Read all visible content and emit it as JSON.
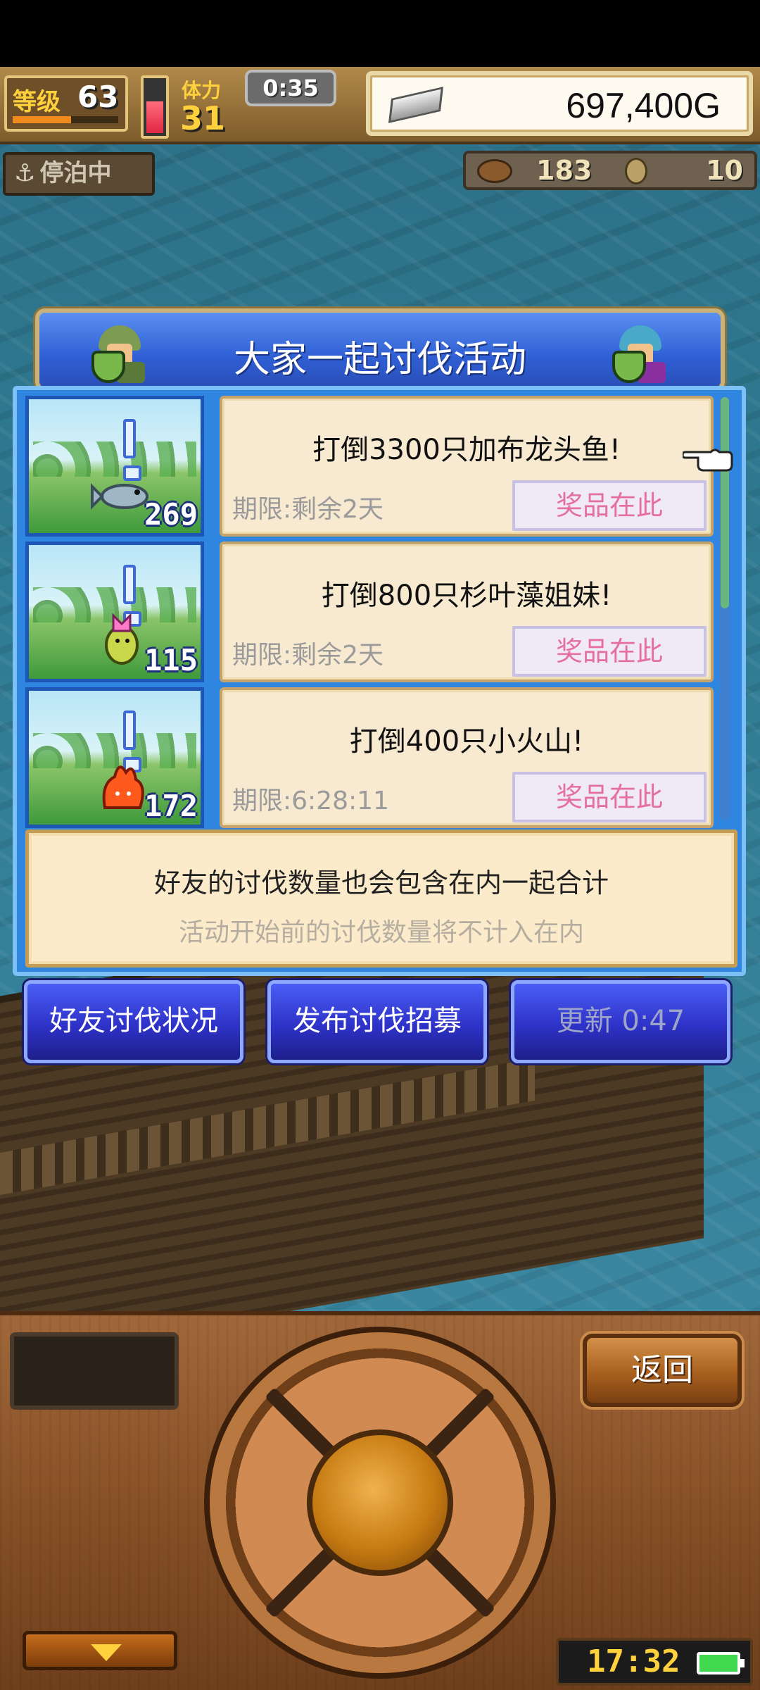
{
  "hud": {
    "level_label": "等级",
    "level": "63",
    "stamina_label": "体力",
    "stamina": "31",
    "timer": "0:35",
    "gold": "697,400G",
    "dock_status": "停泊中",
    "resource_1": "183",
    "resource_2": "10"
  },
  "event": {
    "title": "大家一起讨伐活动",
    "missions": [
      {
        "count": "269",
        "text": "打倒3300只加布龙头鱼!",
        "deadline": "期限:剩余2天",
        "prize": "奖品在此"
      },
      {
        "count": "115",
        "text": "打倒800只杉叶藻姐妹!",
        "deadline": "期限:剩余2天",
        "prize": "奖品在此"
      },
      {
        "count": "172",
        "text": "打倒400只小火山!",
        "deadline": "期限:6:28:11",
        "prize": "奖品在此"
      }
    ],
    "info_line_1": "好友的讨伐数量也会包含在内一起合计",
    "info_line_2": "活动开始前的讨伐数量将不计入在内"
  },
  "buttons": {
    "friend_status": "好友讨伐状况",
    "post_recruit": "发布讨伐招募",
    "refresh": "更新 0:47",
    "back": "返回"
  },
  "status_bar": {
    "clock": "17:32"
  },
  "colors": {
    "panel_blue": "#2f86e0",
    "prize_pink": "#e46fa0",
    "gold_text": "#ffd23d"
  }
}
